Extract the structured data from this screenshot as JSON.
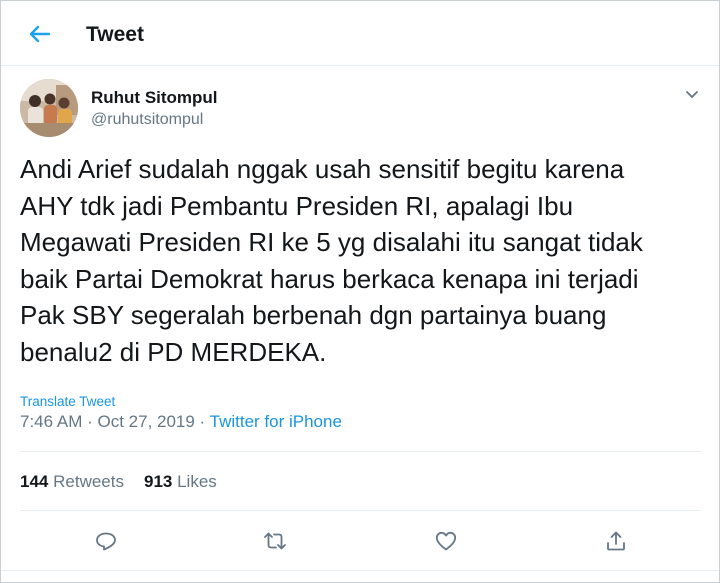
{
  "header": {
    "title": "Tweet",
    "back_icon": "back-arrow-icon"
  },
  "author": {
    "name": "Ruhut Sitompul",
    "handle": "@ruhutsitompul"
  },
  "tweet": {
    "text": "Andi Arief sudalah nggak usah sensitif begitu karena\nAHY tdk jadi Pembantu Presiden RI, apalagi Ibu\nMegawati Presiden RI ke 5 yg disalahi itu sangat tidak\nbaik Partai Demokrat harus berkaca kenapa ini terjadi\nPak SBY segeralah berbenah dgn partainya buang\nbenalu2 di PD MERDEKA.",
    "translate_label": "Translate Tweet",
    "time": "7:46 AM",
    "separator": " · ",
    "date": "Oct 27, 2019",
    "source": "Twitter for iPhone"
  },
  "stats": {
    "retweets_count": "144",
    "retweets_label": "Retweets",
    "likes_count": "913",
    "likes_label": "Likes"
  },
  "actions": [
    "reply-icon",
    "retweet-icon",
    "like-icon",
    "share-icon"
  ],
  "colors": {
    "accent": "#1b95e0",
    "text_primary": "#14171a",
    "text_secondary": "#657786",
    "divider": "#e6ecf0"
  }
}
